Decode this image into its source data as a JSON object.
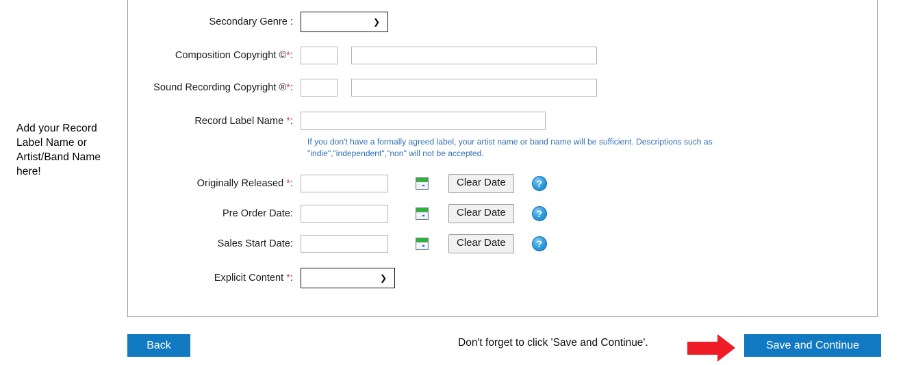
{
  "annotations": {
    "record_label_note": "Add your Record Label Name or Artist/Band Name here!",
    "save_hint": "Don't forget to click 'Save and Continue'.",
    "arrow_record_label_name": "red-arrow-icon",
    "arrow_save_continue_name": "red-arrow-icon"
  },
  "form": {
    "rows": {
      "secondary_genre": {
        "label": "Secondary Genre :",
        "required": false,
        "value": "",
        "options": [
          ""
        ]
      },
      "composition_copyright": {
        "label": "Composition Copyright ©",
        "required": true,
        "year_value": "",
        "owner_value": ""
      },
      "sound_recording_copyright": {
        "label": "Sound Recording Copyright ®",
        "required": true,
        "year_value": "",
        "owner_value": ""
      },
      "record_label_name": {
        "label": "Record Label Name ",
        "required": true,
        "value": "",
        "help_text": "If you don't have a formally agreed label, your artist name or band name will be sufficient. Descriptions such as \"indie\",\"independent\",\"non\" will not be accepted."
      },
      "originally_released": {
        "label": "Originally Released ",
        "required": true,
        "value": "",
        "clear_label": "Clear Date",
        "calendar_icon": "calendar-icon",
        "help_icon": "help-icon"
      },
      "pre_order_date": {
        "label": "Pre Order Date:",
        "required": false,
        "value": "",
        "clear_label": "Clear Date",
        "calendar_icon": "calendar-icon",
        "help_icon": "help-icon"
      },
      "sales_start_date": {
        "label": "Sales Start Date:",
        "required": false,
        "value": "",
        "clear_label": "Clear Date",
        "calendar_icon": "calendar-icon",
        "help_icon": "help-icon"
      },
      "explicit_content": {
        "label": "Explicit Content ",
        "required": true,
        "value": "",
        "options": [
          ""
        ]
      }
    },
    "required_marker": "*",
    "colon": ":"
  },
  "footer": {
    "back_label": "Back",
    "save_continue_label": "Save and Continue"
  },
  "colors": {
    "primary_blue": "#1179C1",
    "arrow_red": "#EE1C25",
    "help_text_blue": "#2F6FB5",
    "required_red": "#E8403A",
    "panel_border": "#9A9A9A"
  }
}
